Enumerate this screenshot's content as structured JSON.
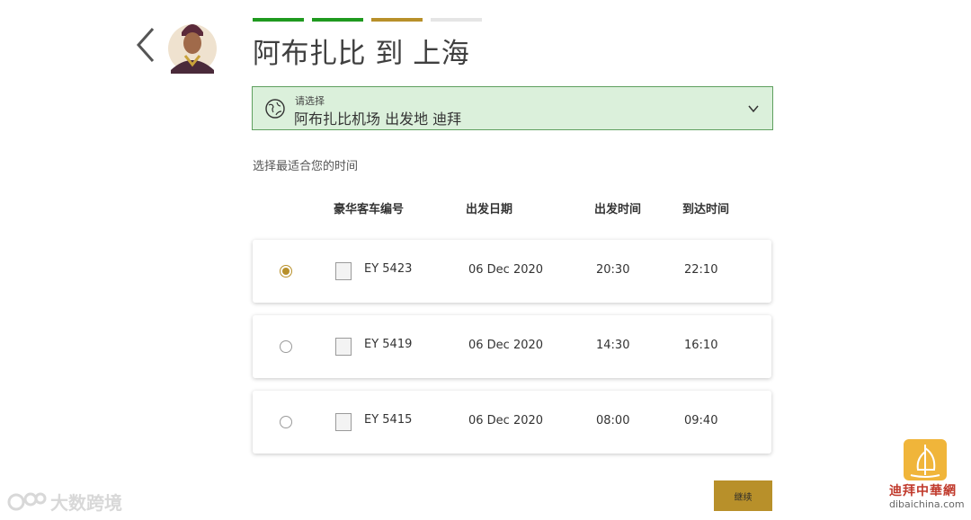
{
  "header": {
    "title": "阿布扎比 到 上海",
    "progress_colors": [
      "#1f9a1f",
      "#1f9a1f",
      "#b8902a",
      "#e5e5e5"
    ]
  },
  "location": {
    "hint": "请选择",
    "value": "阿布扎比机场 出发地 迪拜"
  },
  "instruction": "选择最适合您的时间",
  "columns": {
    "number": "豪华客车编号",
    "date": "出发日期",
    "depart": "出发时间",
    "arrive": "到达时间"
  },
  "options": [
    {
      "number": "EY 5423",
      "date": "06 Dec 2020",
      "depart": "20:30",
      "arrive": "22:10",
      "selected": true
    },
    {
      "number": "EY 5419",
      "date": "06 Dec 2020",
      "depart": "14:30",
      "arrive": "16:10",
      "selected": false
    },
    {
      "number": "EY 5415",
      "date": "06 Dec 2020",
      "depart": "08:00",
      "arrive": "09:40",
      "selected": false
    }
  ],
  "continue_label": "继续",
  "watermarks": {
    "left": "大数跨境",
    "right_cn": "迪拜中華網",
    "right_en": "dibaichina.com"
  },
  "colors": {
    "accent_gold": "#b8902a",
    "accent_green": "#1f9a1f",
    "select_bg": "#dbf0db"
  }
}
